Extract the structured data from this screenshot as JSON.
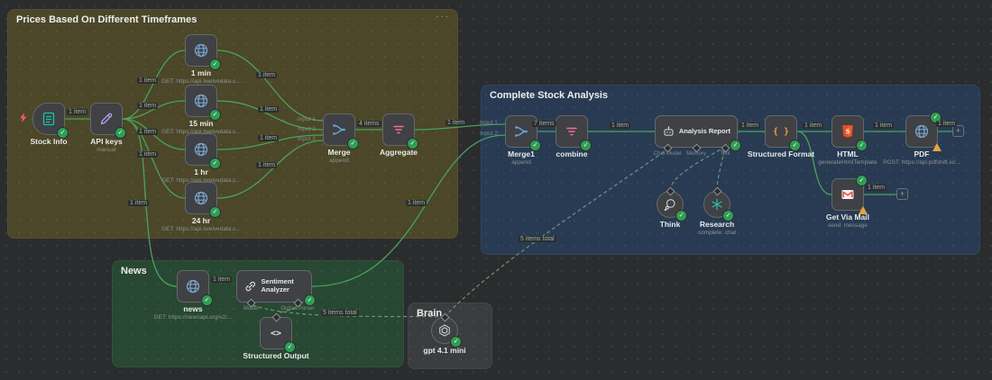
{
  "groups": {
    "prices": {
      "title": "Prices Based On Different Timeframes"
    },
    "analysis": {
      "title": "Complete Stock Analysis"
    },
    "news": {
      "title": "News"
    },
    "brain": {
      "title": "Brain"
    }
  },
  "nodes": {
    "stock_info": {
      "label": "Stock Info"
    },
    "api_keys": {
      "label": "API keys",
      "subtitle": "manual"
    },
    "t1min": {
      "label": "1 min",
      "subtitle": "GET: https://api.twelvedata.c..."
    },
    "t15min": {
      "label": "15 min",
      "subtitle": "GET: https://api.twelvedata.c..."
    },
    "t1hr": {
      "label": "1 hr",
      "subtitle": "GET: https://api.twelvedata.c..."
    },
    "t24hr": {
      "label": "24 hr",
      "subtitle": "GET: https://api.twelvedata.c..."
    },
    "merge": {
      "label": "Merge",
      "subtitle": "append"
    },
    "aggregate": {
      "label": "Aggregate"
    },
    "merge1": {
      "label": "Merge1",
      "subtitle": "append"
    },
    "combine": {
      "label": "combine"
    },
    "analysis_report": {
      "label": "Analysis Report"
    },
    "think": {
      "label": "Think"
    },
    "research": {
      "label": "Research",
      "subtitle": "complete: chat"
    },
    "structured_format": {
      "label": "Structured Format"
    },
    "html": {
      "label": "HTML",
      "subtitle": "generateHtmlTemplate"
    },
    "pdf": {
      "label": "PDF",
      "subtitle": "POST: https://api.pdfshift.io/..."
    },
    "get_via_mail": {
      "label": "Get Via Mail",
      "subtitle": "send: message"
    },
    "news_http": {
      "label": "news",
      "subtitle": "GET: https://newsapi.org/v2/..."
    },
    "sentiment_analyzer": {
      "label": "Sentiment Analyzer"
    },
    "structured_output": {
      "label": "Structured Output"
    },
    "gpt": {
      "label": "gpt 4.1 mini"
    }
  },
  "ports": {
    "input1": "Input 1",
    "input2": "Input 2",
    "input3": "Input 3",
    "chat_model": "Chat Model",
    "memory": "Memory",
    "tool": "Tool",
    "model": "Model",
    "output_parser": "Output Parser"
  },
  "edge_labels": {
    "one_item": "1 item",
    "four_items": "4 items",
    "seven_items": "7 items",
    "five_items_total": "5 items total"
  },
  "icons": {
    "check": "✓",
    "plus": "+",
    "dots": "···",
    "braces": "{ }",
    "code": "<>",
    "html5_digit": "5"
  },
  "colors": {
    "connection_green": "#4aa35c",
    "warning_orange": "#e8a33d",
    "success_green": "#2f9e55"
  }
}
